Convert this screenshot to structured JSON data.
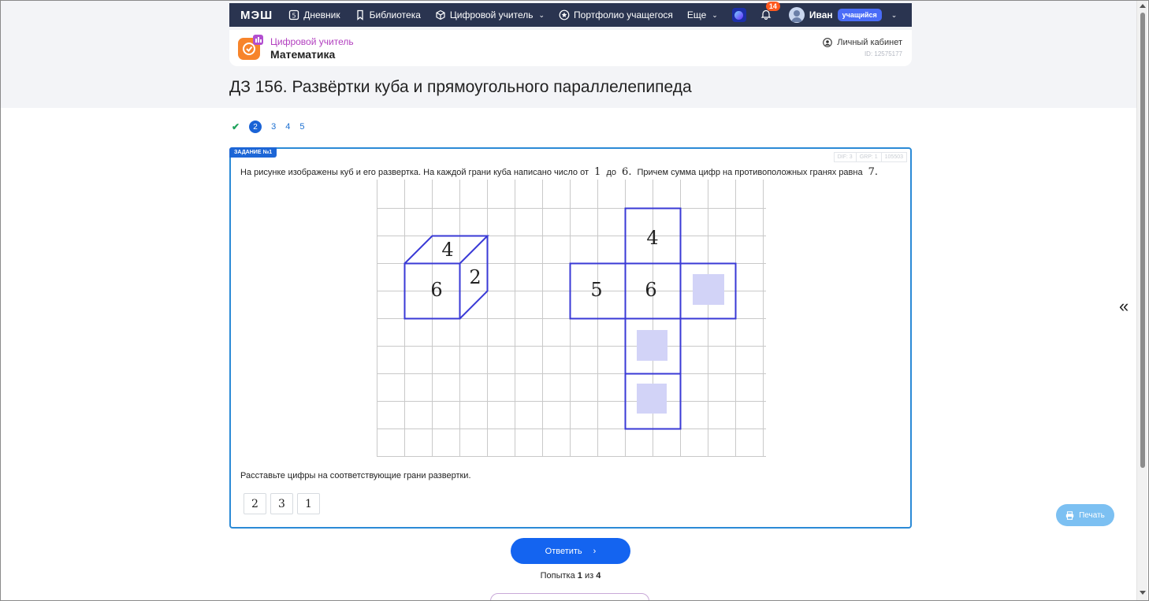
{
  "navbar": {
    "logo": "МЭШ",
    "items": [
      {
        "label": "Дневник",
        "icon": "diary-icon"
      },
      {
        "label": "Библиотека",
        "icon": "bookmark-icon"
      },
      {
        "label": "Цифровой учитель",
        "icon": "cube-icon",
        "dropdown": true
      },
      {
        "label": "Портфолио учащегося",
        "icon": "star-icon"
      },
      {
        "label": "Еще",
        "dropdown": true
      }
    ],
    "notifications_count": "14",
    "user_name": "Иван",
    "user_role": "учащийся"
  },
  "subject": {
    "subtitle": "Цифровой учитель",
    "title": "Математика",
    "cabinet_label": "Личный кабинет",
    "id_text": "ID: 12575177"
  },
  "page_title": "ДЗ 156. Развёртки куба и прямоугольного параллелепипеда",
  "pager": {
    "current": "2",
    "pages": [
      "3",
      "4",
      "5"
    ]
  },
  "task": {
    "label": "ЗАДАНИЕ №1",
    "meta": [
      "DIF: 3",
      "GRP: 1",
      "105503"
    ],
    "text_before": "На рисунке изображены куб и его развертка. На каждой грани куба написано число от",
    "num_from": "1",
    "text_between": "до",
    "num_to": "6.",
    "text_after": "Причем сумма цифр на противоположных гранях равна",
    "num_sum": "7.",
    "cube_labels": {
      "top": "4",
      "front": "6",
      "right": "2"
    },
    "net_labels": {
      "top": "4",
      "left": "5",
      "center": "6"
    },
    "instruction": "Расставьте цифры на соответствующие грани развертки.",
    "chips": [
      "2",
      "3",
      "1"
    ]
  },
  "answer_button": "Ответить",
  "attempts": {
    "prefix": "Попытка",
    "current": "1",
    "middle": "из",
    "total": "4"
  },
  "print_label": "Печать",
  "colors": {
    "navbar": "#2a3450",
    "accent": "#1464f0",
    "figure_stroke": "#3a3ad6",
    "drop_target": "#d2d3f7"
  }
}
